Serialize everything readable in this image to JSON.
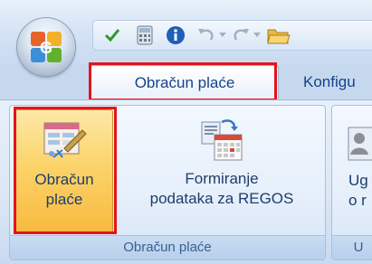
{
  "tabs": {
    "active_label": "Obračun plaće",
    "next_label": "Konfigu"
  },
  "ribbon": {
    "group1": {
      "caption": "Obračun plaće",
      "btn1_line1": "Obračun",
      "btn1_line2": "plaće",
      "btn2_line1": "Formiranje",
      "btn2_line2": "podataka za REGOS"
    },
    "group2": {
      "caption": "U",
      "btn_line1": "Ug",
      "btn_line2": "o r"
    }
  },
  "colors": {
    "highlight": "#e3141b",
    "accent_text": "#15428b"
  }
}
